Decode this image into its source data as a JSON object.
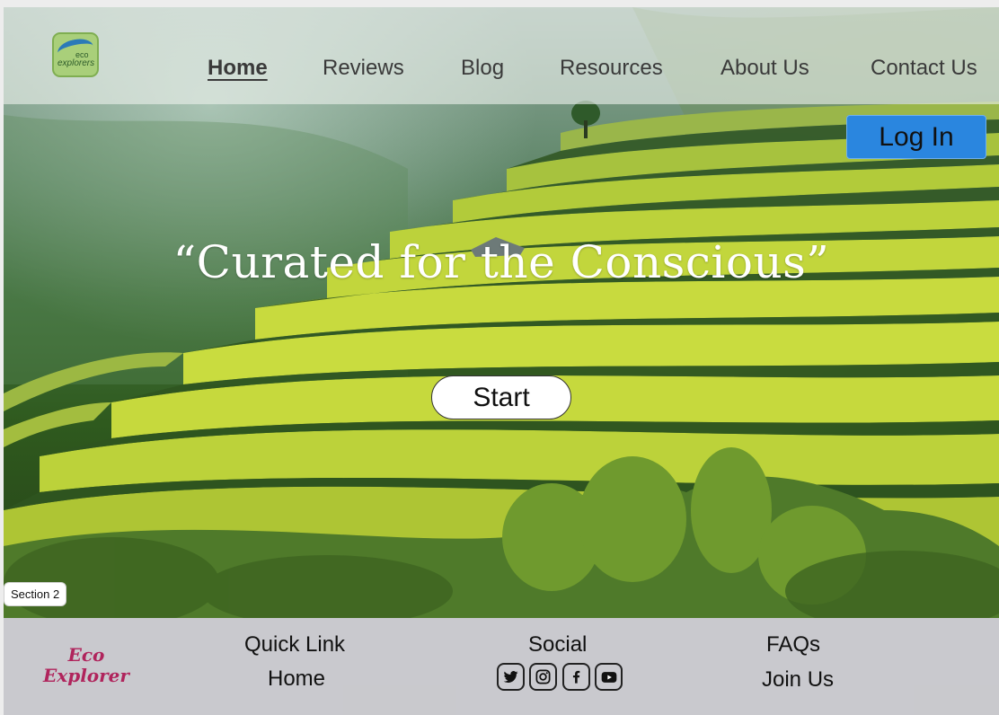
{
  "header": {
    "logo_text_top": "eco",
    "logo_text_bottom": "explorers",
    "nav": [
      {
        "label": "Home",
        "active": true
      },
      {
        "label": "Reviews",
        "active": false
      },
      {
        "label": "Blog",
        "active": false
      },
      {
        "label": "Resources",
        "active": false
      },
      {
        "label": "About Us",
        "active": false
      },
      {
        "label": "Contact Us",
        "active": false
      }
    ],
    "login_label": "Log In"
  },
  "hero": {
    "tagline": "“Curated for the Conscious”",
    "start_label": "Start",
    "section_badge": "Section 2"
  },
  "footer": {
    "brand_line1": "Eco",
    "brand_line2": "Explorer",
    "quick_link_heading": "Quick Link",
    "quick_links": [
      "Home"
    ],
    "social_heading": "Social",
    "social_icons": [
      "twitter-icon",
      "instagram-icon",
      "facebook-icon",
      "youtube-icon"
    ],
    "faqs_label": "FAQs",
    "join_label": "Join Us"
  },
  "colors": {
    "accent_button": "#2a86df",
    "brand_text": "#b0245c",
    "footer_bg": "#c3c3c8"
  }
}
